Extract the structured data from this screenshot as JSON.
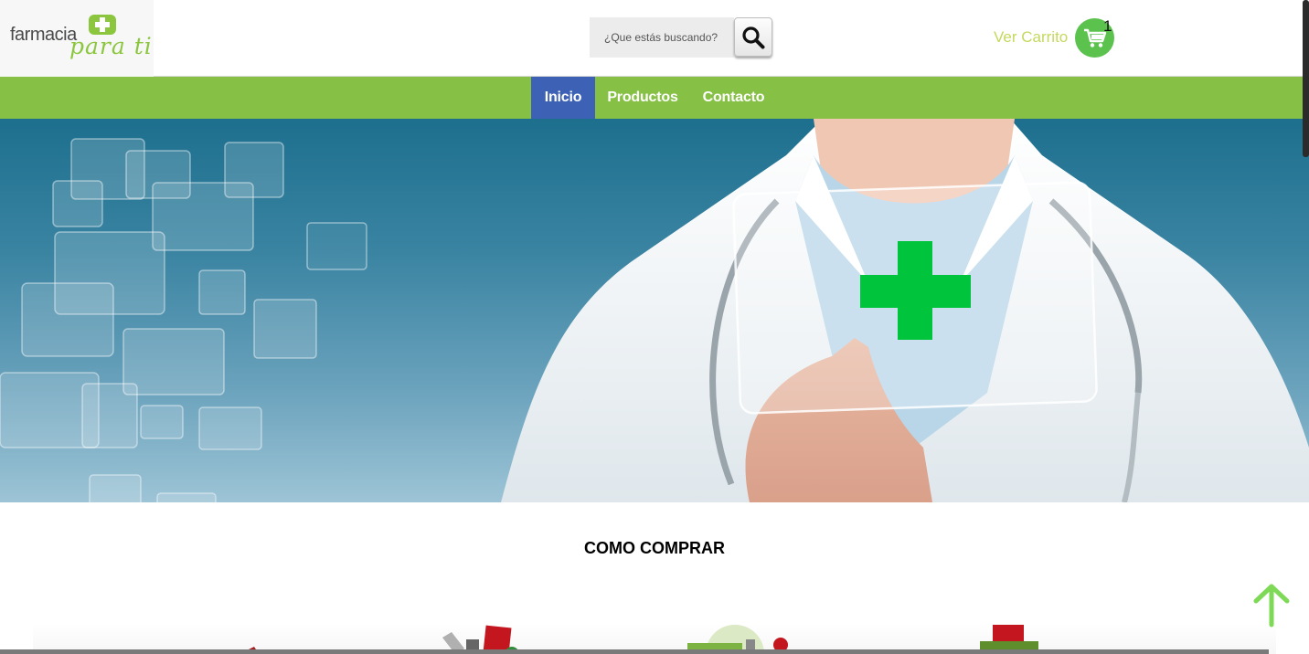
{
  "header": {
    "logo": {
      "word": "farmacia",
      "script": "para ti"
    },
    "search": {
      "placeholder": "¿Que estás buscando?"
    },
    "cart": {
      "label": "Ver Carrito",
      "count": "1"
    }
  },
  "nav": {
    "items": [
      {
        "label": "Inicio",
        "active": true
      },
      {
        "label": "Productos",
        "active": false
      },
      {
        "label": "Contacto",
        "active": false
      }
    ]
  },
  "section": {
    "title": "COMO COMPRAR"
  },
  "colors": {
    "brand_green": "#86c045",
    "active_blue": "#3d62b5",
    "cart_green": "#5cc24e",
    "cross_green": "#00c43b"
  }
}
